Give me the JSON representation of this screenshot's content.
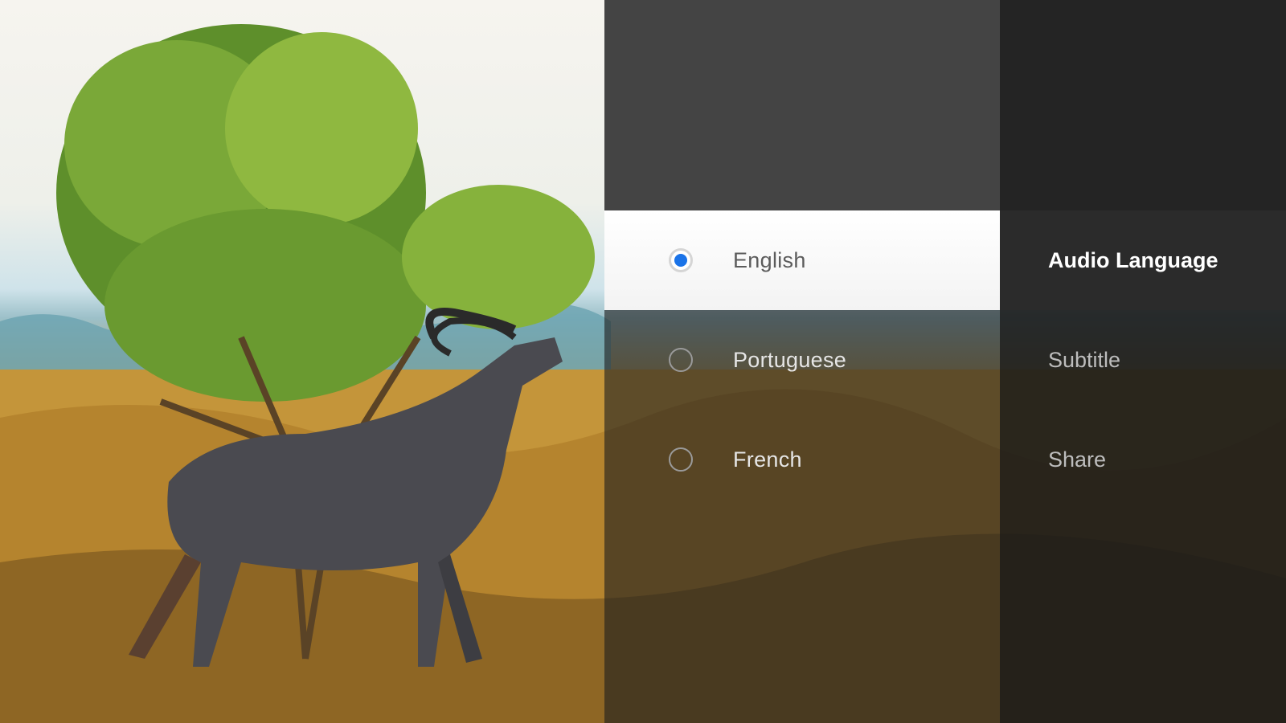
{
  "languages": {
    "options": [
      {
        "label": "English",
        "selected": true
      },
      {
        "label": "Portuguese",
        "selected": false
      },
      {
        "label": "French",
        "selected": false
      }
    ],
    "selected_color": "#1a73e8"
  },
  "menu": {
    "items": [
      {
        "label": "Audio Language",
        "active": true
      },
      {
        "label": "Subtitle",
        "active": false
      },
      {
        "label": "Share",
        "active": false
      }
    ]
  },
  "colors": {
    "options_top": "#444444",
    "categories_bg": "#1a1a1a",
    "selected_row_bg": "#ffffff"
  }
}
